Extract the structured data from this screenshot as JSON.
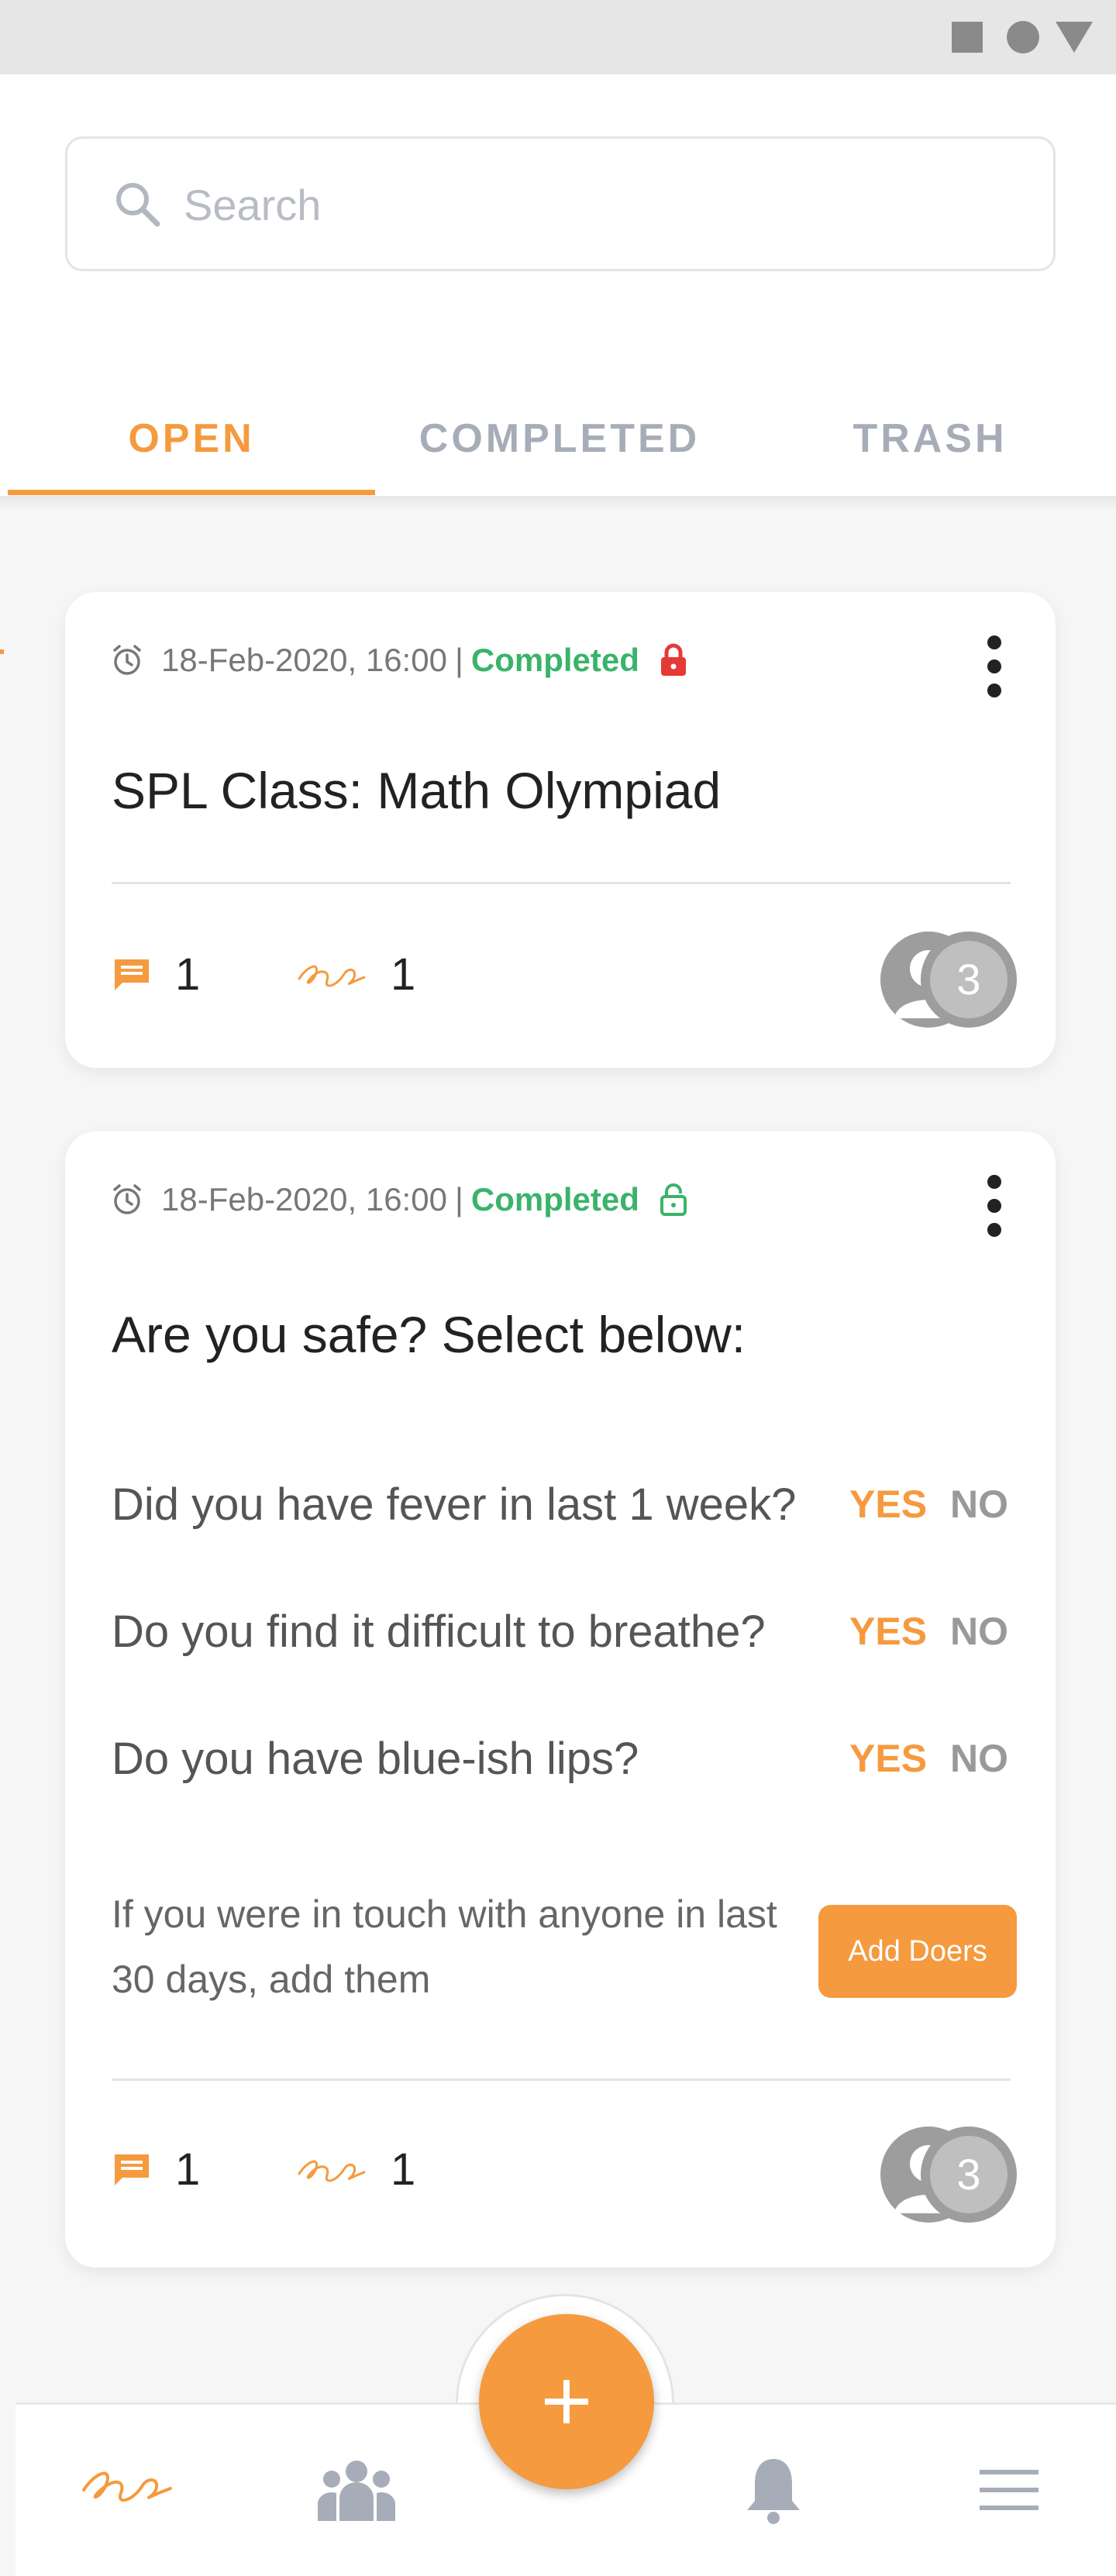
{
  "colors": {
    "accent": "#f59a3e",
    "completed_green": "#3bb36a",
    "lock_red": "#e53935",
    "tab_inactive": "#a7adb8"
  },
  "search": {
    "placeholder": "Search"
  },
  "tabs": [
    {
      "label": "OPEN",
      "active": true
    },
    {
      "label": "COMPLETED",
      "active": false
    },
    {
      "label": "TRASH",
      "active": false
    }
  ],
  "cards": [
    {
      "datetime": "18-Feb-2020, 16:00",
      "separator": "|",
      "status": "Completed",
      "lock_icon": "lock-closed-icon",
      "title": "SPL Class: Math Olympiad",
      "comments": "1",
      "doers": "1",
      "avatar_count": "3"
    },
    {
      "datetime": "18-Feb-2020, 16:00",
      "separator": "|",
      "status": "Completed",
      "lock_icon": "lock-open-icon",
      "title": "Are you safe? Select below:",
      "questions": [
        {
          "text": "Did you have fever in last 1 week?",
          "yes": "YES",
          "no": "NO"
        },
        {
          "text": "Do you find it difficult to breathe?",
          "yes": "YES",
          "no": "NO"
        },
        {
          "text": "Do you have blue-ish lips?",
          "yes": "YES",
          "no": "NO"
        }
      ],
      "note": "If you were in touch with anyone in last 30 days, add them",
      "add_doers_label": "Add Doers",
      "comments": "1",
      "doers": "1",
      "avatar_count": "3"
    }
  ],
  "bottom_nav": {
    "items": [
      "logo-icon",
      "group-icon",
      "add-icon",
      "bell-icon",
      "menu-icon"
    ]
  }
}
